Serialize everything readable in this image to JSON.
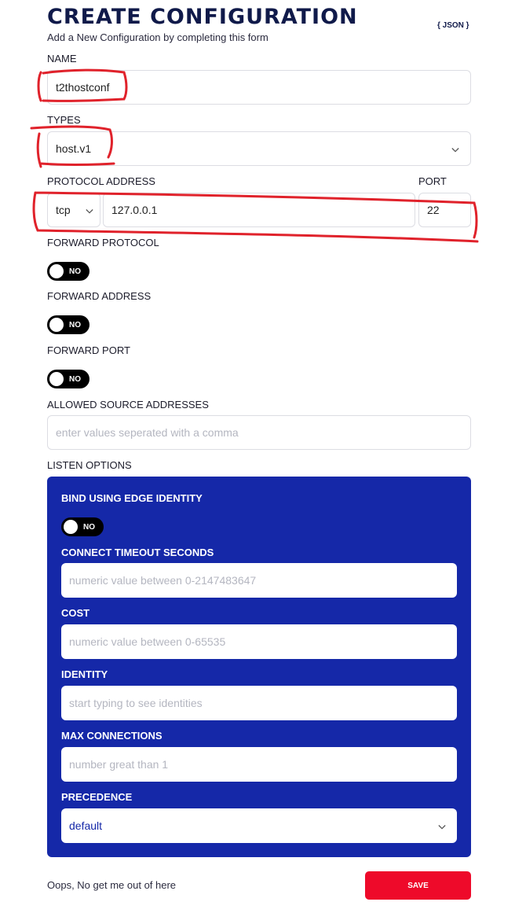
{
  "header": {
    "title": "CREATE CONFIGURATION",
    "subtitle": "Add a New Configuration by completing this form",
    "json_link": "{ JSON }"
  },
  "form": {
    "name": {
      "label": "NAME",
      "value": "t2thostconf"
    },
    "types": {
      "label": "TYPES",
      "value": "host.v1"
    },
    "protocol_address": {
      "label": "PROTOCOL ADDRESS",
      "protocol": "tcp",
      "address": "127.0.0.1"
    },
    "port": {
      "label": "PORT",
      "value": "22"
    },
    "forward_protocol": {
      "label": "FORWARD PROTOCOL",
      "toggle": "NO"
    },
    "forward_address": {
      "label": "FORWARD ADDRESS",
      "toggle": "NO"
    },
    "forward_port": {
      "label": "FORWARD PORT",
      "toggle": "NO"
    },
    "allowed_source": {
      "label": "ALLOWED SOURCE ADDRESSES",
      "placeholder": "enter values seperated with a comma"
    },
    "listen_options_label": "LISTEN OPTIONS"
  },
  "listen": {
    "bind_edge": {
      "label": "BIND USING EDGE IDENTITY",
      "toggle": "NO"
    },
    "connect_timeout": {
      "label": "CONNECT TIMEOUT SECONDS",
      "placeholder": "numeric value between 0-2147483647"
    },
    "cost": {
      "label": "COST",
      "placeholder": "numeric value between 0-65535"
    },
    "identity": {
      "label": "IDENTITY",
      "placeholder": "start typing to see identities"
    },
    "max_connections": {
      "label": "MAX CONNECTIONS",
      "placeholder": "number great than 1"
    },
    "precedence": {
      "label": "PRECEDENCE",
      "value": "default"
    }
  },
  "footer": {
    "cancel": "Oops, No get me out of here",
    "save": "SAVE"
  },
  "colors": {
    "panel": "#1528a8",
    "save": "#ee0a2a",
    "title": "#101a4a",
    "annotation": "#e0222b"
  }
}
